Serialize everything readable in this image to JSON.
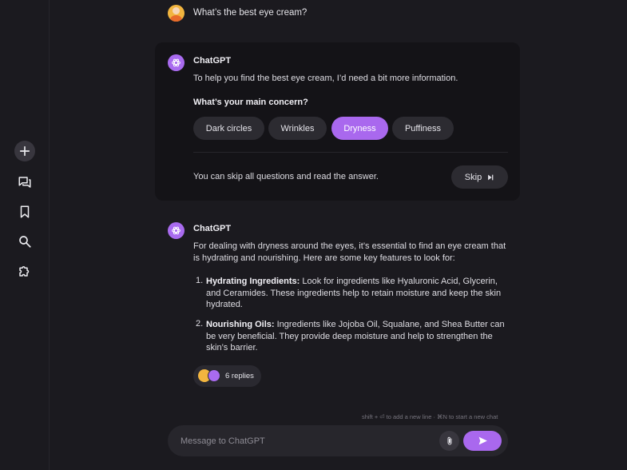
{
  "user_message": "What’s the best eye cream?",
  "assistant_name": "ChatGPT",
  "card": {
    "intro": "To help you find the best eye cream, I’d need a bit more information.",
    "question": "What’s your main concern?",
    "options": [
      {
        "label": "Dark circles",
        "selected": false
      },
      {
        "label": "Wrinkles",
        "selected": false
      },
      {
        "label": "Dryness",
        "selected": true
      },
      {
        "label": "Puffiness",
        "selected": false
      }
    ],
    "skip_text": "You can skip all questions and read the answer.",
    "skip_label": "Skip"
  },
  "answer": {
    "intro": "For dealing with dryness around the eyes, it’s essential to find an eye cream that is hydrating and nourishing. Here are some key features to look for:",
    "items": [
      {
        "num": "1.",
        "title": "Hydrating Ingredients:",
        "text": " Look for ingredients like Hyaluronic Acid, Glycerin, and Ceramides. These ingredients help to retain moisture and keep the skin hydrated."
      },
      {
        "num": "2.",
        "title": "Nourishing Oils:",
        "text": " Ingredients like Jojoba Oil, Squalane, and Shea Butter can be very beneficial. They provide deep moisture and help to strengthen the skin’s barrier."
      }
    ],
    "replies_label": "6 replies"
  },
  "composer": {
    "hint": "shift + ⏎ to add a new line  ·  ⌘N to start a new chat",
    "placeholder": "Message to ChatGPT"
  },
  "icons": {
    "sidebar": [
      "plus-icon",
      "chats-icon",
      "bookmark-icon",
      "search-icon",
      "puzzle-icon"
    ]
  },
  "colors": {
    "accent": "#a968ee",
    "background": "#1b1a1f",
    "card": "#141317"
  }
}
